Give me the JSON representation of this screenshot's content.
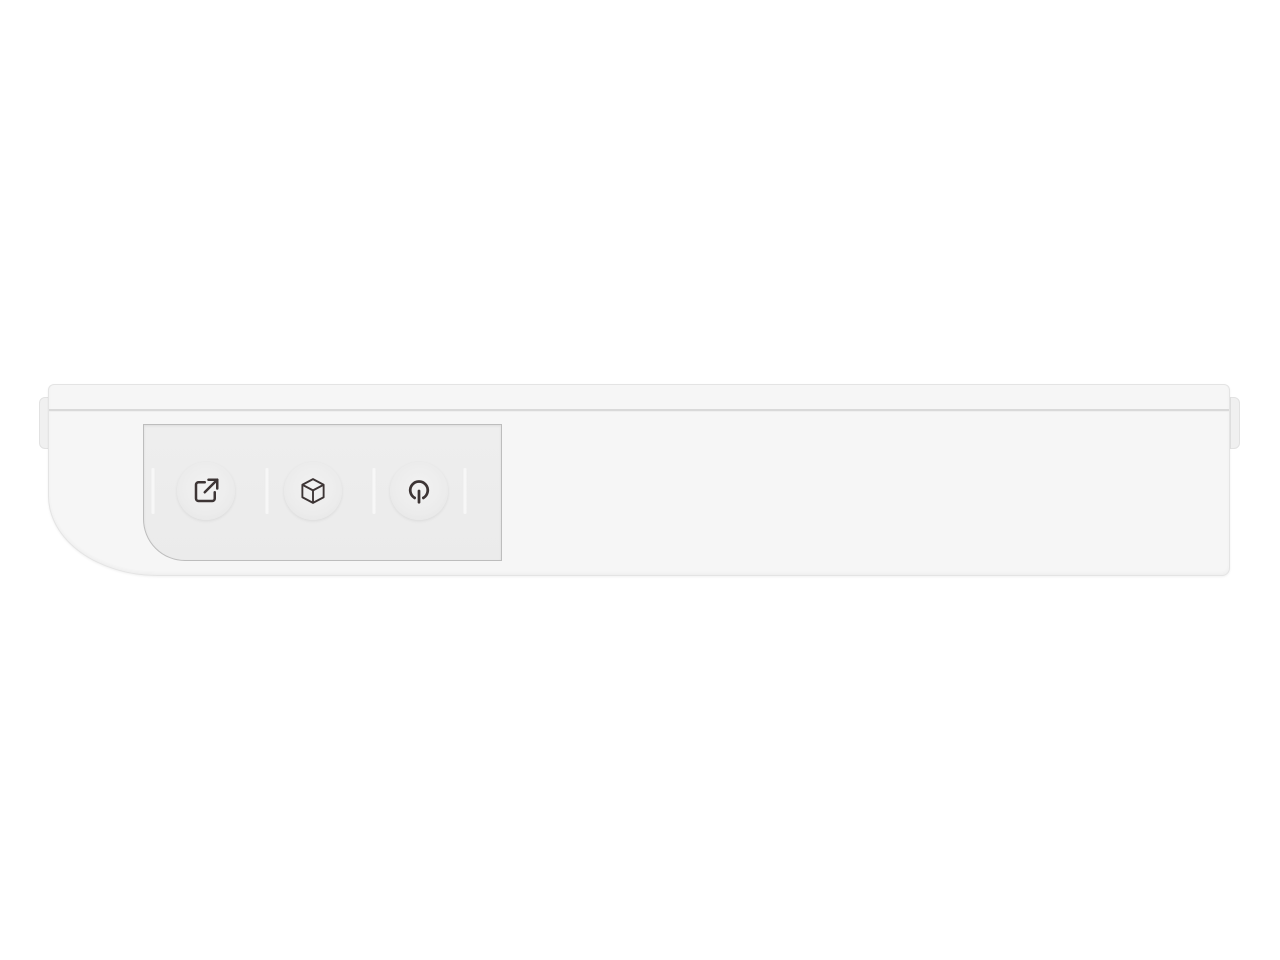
{
  "device": {
    "buttons": [
      {
        "name": "open-external",
        "icon": "external-link-icon"
      },
      {
        "name": "box",
        "icon": "cube-icon"
      },
      {
        "name": "power",
        "icon": "power-icon"
      }
    ]
  },
  "colors": {
    "body": "#f6f6f6",
    "panel": "#ececec",
    "panel_border": "#bdbdbd",
    "icon": "#3d3535"
  }
}
